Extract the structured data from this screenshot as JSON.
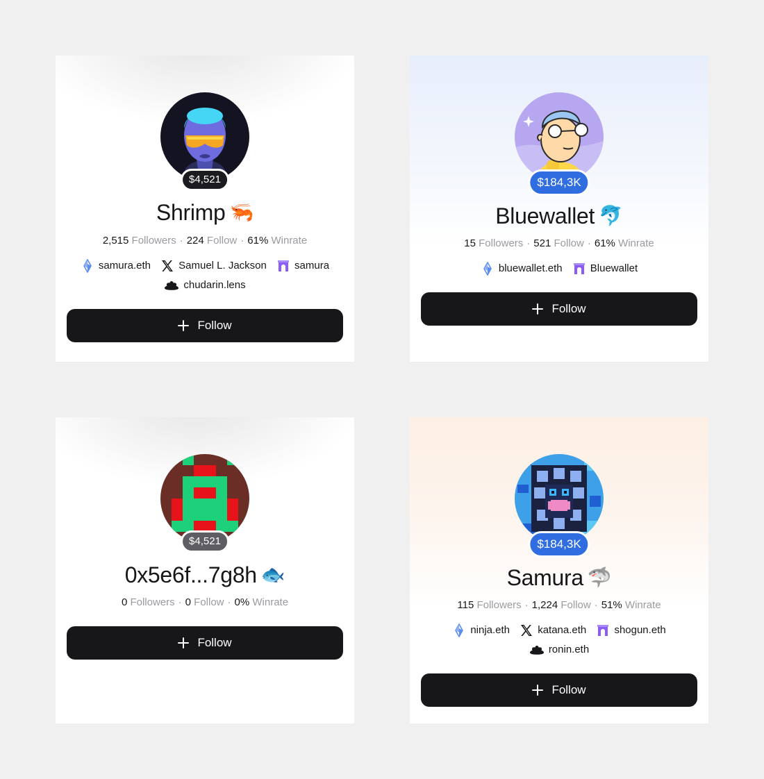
{
  "cards": [
    {
      "name": "Shrimp",
      "emoji": "🦐",
      "balance": "$4,521",
      "balance_color": "#1c1c20",
      "stats": {
        "followers": "2,515",
        "followers_label": "Followers",
        "follow": "224",
        "follow_label": "Follow",
        "winrate": "61%",
        "winrate_label": "Winrate"
      },
      "links": [
        {
          "icon": "ens-icon",
          "label": "samura.eth"
        },
        {
          "icon": "x-icon",
          "label": "Samuel L. Jackson"
        },
        {
          "icon": "farcaster-icon",
          "label": "samura"
        },
        {
          "icon": "lens-icon",
          "label": "chudarin.lens"
        }
      ],
      "button": "Follow"
    },
    {
      "name": "Bluewallet",
      "emoji": "🐬",
      "balance": "$184,3K",
      "balance_color": "#2f6de1",
      "stats": {
        "followers": "15",
        "followers_label": "Followers",
        "follow": "521",
        "follow_label": "Follow",
        "winrate": "61%",
        "winrate_label": "Winrate"
      },
      "links": [
        {
          "icon": "ens-icon",
          "label": "bluewallet.eth"
        },
        {
          "icon": "farcaster-icon",
          "label": "Bluewallet"
        }
      ],
      "button": "Follow"
    },
    {
      "name": "0x5e6f...7g8h",
      "emoji": "🐟",
      "balance": "$4,521",
      "balance_color": "#5d5d63",
      "stats": {
        "followers": "0",
        "followers_label": "Followers",
        "follow": "0",
        "follow_label": "Follow",
        "winrate": "0%",
        "winrate_label": "Winrate"
      },
      "links": [],
      "button": "Follow"
    },
    {
      "name": "Samura",
      "emoji": "🦈",
      "balance": "$184,3K",
      "balance_color": "#2f6de1",
      "stats": {
        "followers": "115",
        "followers_label": "Followers",
        "follow": "1,224",
        "follow_label": "Follow",
        "winrate": "51%",
        "winrate_label": "Winrate"
      },
      "links": [
        {
          "icon": "ens-icon",
          "label": "ninja.eth"
        },
        {
          "icon": "x-icon",
          "label": "katana.eth"
        },
        {
          "icon": "farcaster-icon",
          "label": "shogun.eth"
        },
        {
          "icon": "lens-icon",
          "label": "ronin.eth"
        }
      ],
      "button": "Follow"
    }
  ]
}
